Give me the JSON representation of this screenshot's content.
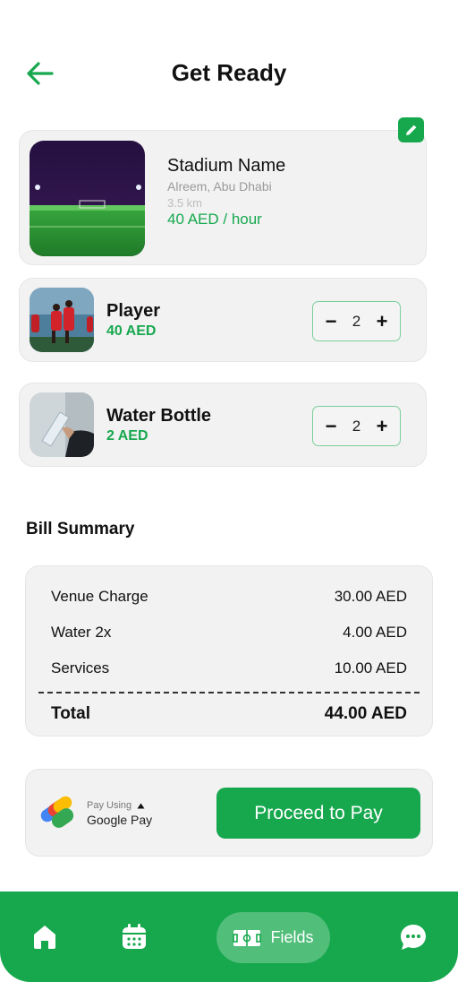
{
  "header": {
    "title": "Get Ready"
  },
  "stadium": {
    "name": "Stadium Name",
    "location": "Alreem, Abu Dhabi",
    "distance": "3.5 km",
    "price": "40 AED / hour"
  },
  "items": [
    {
      "name": "Player",
      "price": "40 AED",
      "quantity": "2",
      "minus": "−",
      "plus": "+"
    },
    {
      "name": "Water Bottle",
      "price": "2 AED",
      "quantity": "2",
      "minus": "−",
      "plus": "+"
    }
  ],
  "bill": {
    "title": "Bill Summary",
    "rows": [
      {
        "label": "Venue Charge",
        "value": "30.00 AED"
      },
      {
        "label": "Water 2x",
        "value": "4.00 AED"
      },
      {
        "label": "Services",
        "value": "10.00 AED"
      }
    ],
    "total_label": "Total",
    "total_value": "44.00 AED"
  },
  "payment": {
    "pay_using": "Pay Using",
    "method": "Google Pay",
    "proceed_label": "Proceed to Pay"
  },
  "nav": {
    "fields_label": "Fields"
  },
  "colors": {
    "accent": "#17a84e",
    "card_bg": "#f2f2f2"
  }
}
